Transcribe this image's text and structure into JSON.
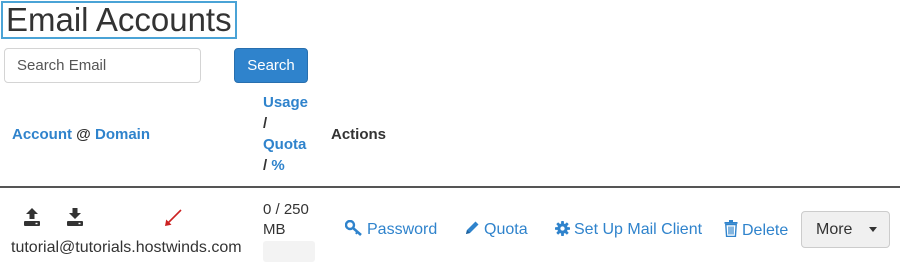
{
  "page": {
    "title": "Email Accounts"
  },
  "search": {
    "placeholder": "Search Email",
    "value": "",
    "button_label": "Search"
  },
  "table": {
    "headers": {
      "account": "Account",
      "at": "@",
      "domain": "Domain",
      "usage": "Usage",
      "slash1": "/",
      "quota": "Quota",
      "slash2": "/",
      "percent": "%",
      "actions": "Actions"
    },
    "rows": [
      {
        "email": "tutorial@tutorials.hostwinds.com",
        "usage_line1": "0 / 250",
        "usage_line2": "MB",
        "usage_fraction": 0,
        "icons": [
          "upload-icon",
          "download-icon"
        ],
        "actions": {
          "password": "Password",
          "quota": "Quota",
          "setup": "Set Up Mail Client",
          "delete": "Delete",
          "more": "More"
        }
      }
    ]
  },
  "colors": {
    "link": "#2f83cc",
    "title_border": "#4aa3d6",
    "arrow": "#cc2222"
  },
  "icons": {
    "password": "key-icon",
    "quota": "pencil-icon",
    "setup": "gear-icon",
    "delete": "trash-icon",
    "more": "caret-down-icon"
  }
}
